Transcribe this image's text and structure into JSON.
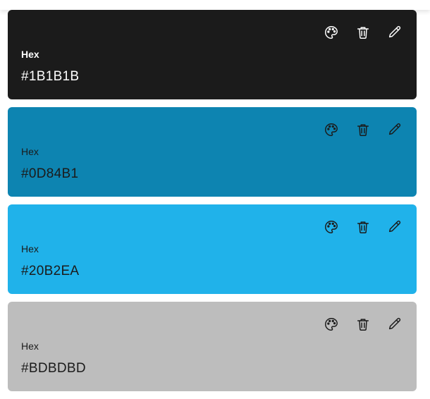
{
  "swatches": [
    {
      "label": "Hex",
      "value": "#1B1B1B",
      "color": "#1B1B1B",
      "text_color": "#ffffff"
    },
    {
      "label": "Hex",
      "value": "#0D84B1",
      "color": "#0D84B1",
      "text_color": "#1b1b1b"
    },
    {
      "label": "Hex",
      "value": "#20B2EA",
      "color": "#20B2EA",
      "text_color": "#1b1b1b"
    },
    {
      "label": "Hex",
      "value": "#BDBDBD",
      "color": "#BDBDBD",
      "text_color": "#1b1b1b"
    }
  ],
  "icons": {
    "palette": "palette-icon",
    "delete": "trash-icon",
    "edit": "pencil-icon"
  }
}
